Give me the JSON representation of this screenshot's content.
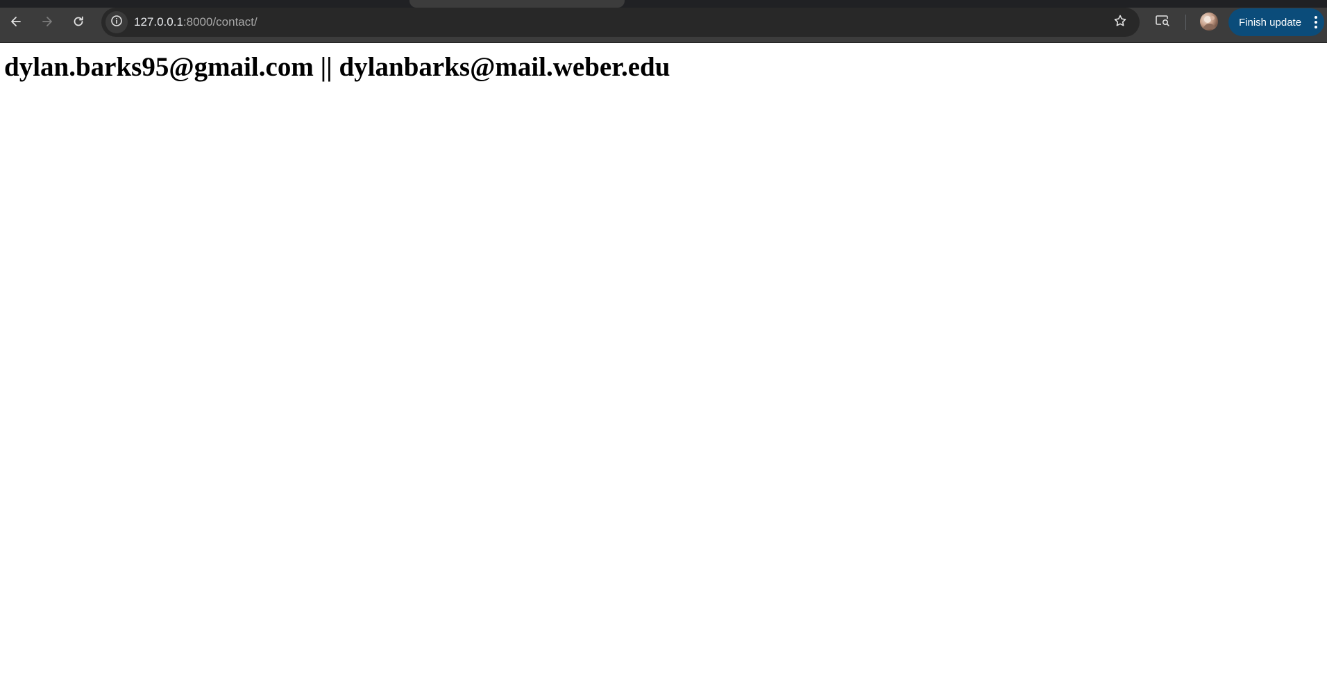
{
  "browser": {
    "url_host": "127.0.0.1",
    "url_path": ":8000/contact/",
    "update_button_label": "Finish update",
    "icons": {
      "back": "arrow-left-icon",
      "forward": "arrow-right-icon",
      "reload": "reload-icon",
      "site_info": "info-icon",
      "bookmark": "star-icon",
      "tab_search": "tab-search-icon",
      "profile": "avatar",
      "menu": "kebab-menu-icon"
    },
    "colors": {
      "toolbar": "#3c3c3c",
      "omnibox": "#282828",
      "update_button": "#0b4c7a"
    }
  },
  "page": {
    "heading": "dylan.barks95@gmail.com || dylanbarks@mail.weber.edu"
  }
}
